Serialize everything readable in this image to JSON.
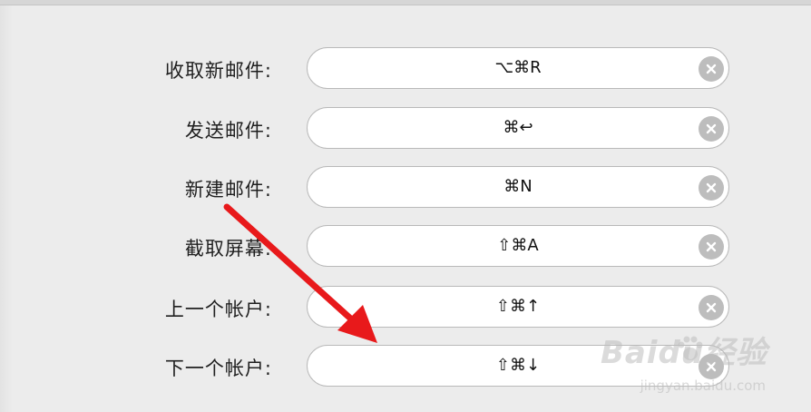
{
  "shortcuts": [
    {
      "label": "收取新邮件:",
      "keys": "⌥⌘R"
    },
    {
      "label": "发送邮件:",
      "keys": "⌘↩"
    },
    {
      "label": "新建邮件:",
      "keys": "⌘N"
    },
    {
      "label": "截取屏幕:",
      "keys": "⇧⌘A"
    },
    {
      "label": "上一个帐户:",
      "keys": "⇧⌘↑"
    },
    {
      "label": "下一个帐户:",
      "keys": "⇧⌘↓"
    }
  ],
  "icons": {
    "clear": "clear-circle-icon",
    "annotation": "red-arrow-annotation"
  },
  "colors": {
    "background": "#ececec",
    "field": "#ffffff",
    "clear_button": "#bdbdbd",
    "annotation_arrow": "#e8191b"
  },
  "watermark": {
    "brand": "Baidu经验",
    "url": "jingyan.baidu.com"
  }
}
